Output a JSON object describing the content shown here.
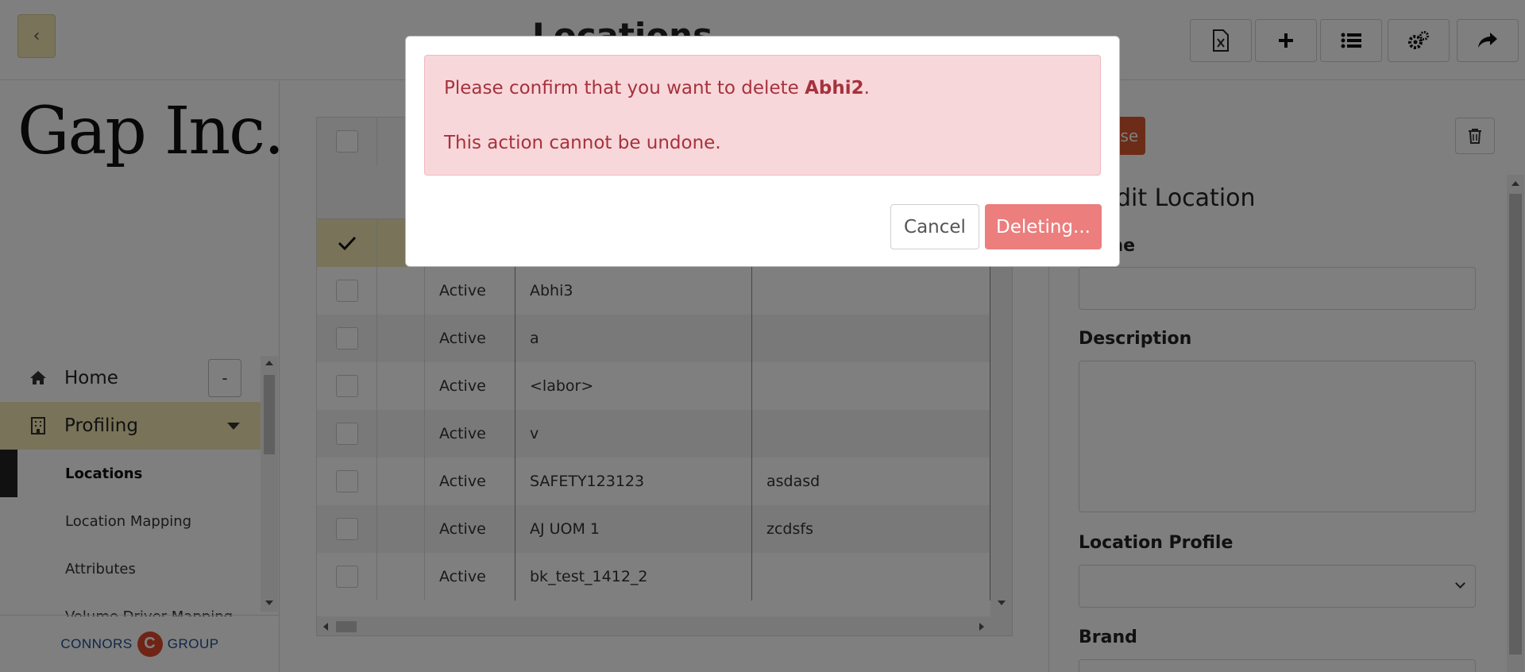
{
  "header": {
    "title": "Locations",
    "back_icon": "chevron-left-icon",
    "toolbar_icons": [
      "excel-export-icon",
      "plus-icon",
      "list-icon",
      "gears-icon",
      "share-icon"
    ]
  },
  "sidebar": {
    "brand": "Gap Inc.",
    "collapse_label": "-",
    "nav": [
      {
        "label": "Home",
        "icon": "home-icon"
      },
      {
        "label": "Profiling",
        "icon": "building-icon"
      }
    ],
    "sub_items": [
      {
        "label": "Locations"
      },
      {
        "label": "Location Mapping"
      },
      {
        "label": "Attributes"
      },
      {
        "label": "Volume Driver Mapping"
      }
    ],
    "footer_logo": {
      "left": "CONNORS",
      "right": "GROUP"
    }
  },
  "grid": {
    "rows": [
      {
        "status": "Active",
        "name": "Abhi3",
        "description": ""
      },
      {
        "status": "Active",
        "name": "a",
        "description": ""
      },
      {
        "status": "Active",
        "name": "<labor>",
        "description": ""
      },
      {
        "status": "Active",
        "name": "v",
        "description": ""
      },
      {
        "status": "Active",
        "name": "SAFETY123123",
        "description": "asdasd"
      },
      {
        "status": "Active",
        "name": "AJ UOM 1",
        "description": "zcdsfs"
      },
      {
        "status": "Active",
        "name": "bk_test_1412_2",
        "description": ""
      }
    ]
  },
  "form": {
    "close_label": "Close",
    "heading": "Edit Location",
    "name_label": "Name",
    "description_label": "Description",
    "profile_label": "Location Profile",
    "brand_label": "Brand"
  },
  "modal": {
    "message_prefix": "Please confirm that you want to delete ",
    "item_name": "Abhi2",
    "message_suffix": ".",
    "warning": "This action cannot be undone.",
    "cancel_label": "Cancel",
    "delete_label": "Deleting..."
  },
  "colors": {
    "accent": "#f3e6b3",
    "danger": "#ec7e7e",
    "close_button": "#d9582f",
    "alert_text": "#a6323d"
  }
}
